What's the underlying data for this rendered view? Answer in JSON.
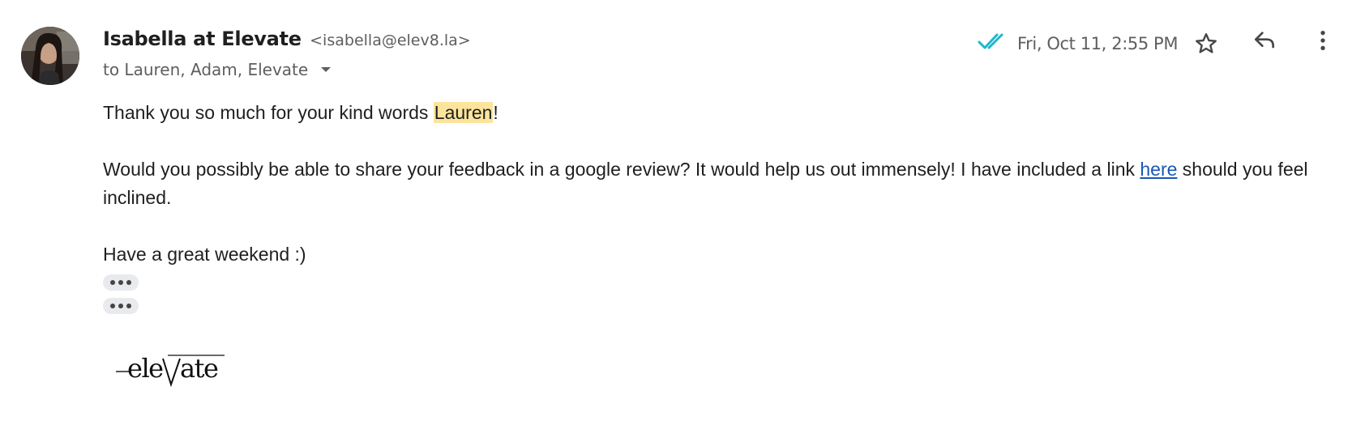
{
  "message": {
    "sender_name": "Isabella at Elevate",
    "sender_email": "<isabella@elev8.la>",
    "recipients": "to Lauren, Adam, Elevate",
    "timestamp": "Fri, Oct 11, 2:55 PM",
    "body": {
      "line1_pre": "Thank you so much for your kind words ",
      "line1_highlight": "Lauren",
      "line1_post": "!",
      "line2_pre": "Would you possibly be able to share your feedback in a google review? It would help us out immensely! I have included a link ",
      "line2_link": "here",
      "line2_post": " should you feel inclined.",
      "line3": "Have a great weekend :)"
    },
    "signature_logo": "elevate"
  },
  "icons": {
    "read_receipt": "double-check-icon",
    "recipients_toggle": "caret-down-icon",
    "star": "star-icon",
    "reply": "reply-icon",
    "more": "more-vertical-icon",
    "trimmed": "ellipsis-icon"
  },
  "colors": {
    "read_check": "#1eb7c9",
    "highlight": "#fde49c",
    "link": "#1a57b8",
    "pill": "#e8eaed"
  }
}
